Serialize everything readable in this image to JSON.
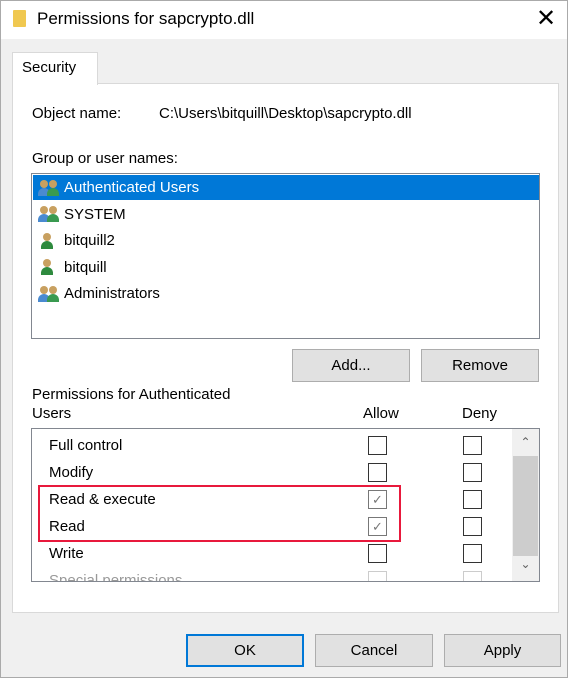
{
  "window": {
    "title": "Permissions for sapcrypto.dll",
    "icon": "folder-icon",
    "close_icon": "close-icon"
  },
  "tab": {
    "label": "Security"
  },
  "object": {
    "label": "Object name:",
    "value": "C:\\Users\\bitquill\\Desktop\\sapcrypto.dll"
  },
  "groups": {
    "label": "Group or user names:",
    "items": [
      {
        "name": "Authenticated Users",
        "type": "group",
        "selected": true
      },
      {
        "name": "SYSTEM",
        "type": "group",
        "selected": false
      },
      {
        "name": "bitquill2",
        "type": "user",
        "selected": false
      },
      {
        "name": "bitquill",
        "type": "user",
        "selected": false
      },
      {
        "name": "Administrators",
        "type": "group",
        "selected": false
      }
    ]
  },
  "buttons": {
    "add": "Add...",
    "remove": "Remove",
    "ok": "OK",
    "cancel": "Cancel",
    "apply": "Apply"
  },
  "permissions": {
    "label": "Permissions for Authenticated Users",
    "allow": "Allow",
    "deny": "Deny",
    "items": [
      {
        "name": "Full control",
        "allow": false,
        "deny": false
      },
      {
        "name": "Modify",
        "allow": false,
        "deny": false
      },
      {
        "name": "Read & execute",
        "allow": true,
        "deny": false
      },
      {
        "name": "Read",
        "allow": true,
        "deny": false
      },
      {
        "name": "Write",
        "allow": false,
        "deny": false
      },
      {
        "name": "Special permissions",
        "allow": false,
        "deny": false
      }
    ]
  },
  "colors": {
    "selection": "#0078d7",
    "highlight_box": "#e8193c"
  }
}
